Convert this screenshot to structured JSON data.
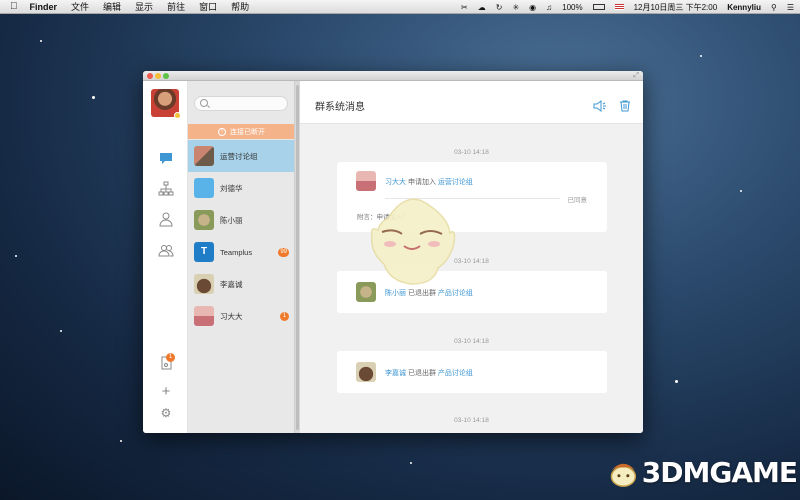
{
  "menubar": {
    "app": "Finder",
    "items": [
      "文件",
      "编辑",
      "显示",
      "前往",
      "窗口",
      "帮助"
    ],
    "battery": "100%",
    "datetime": "12月10日周三 下午2:00",
    "user": "Kennyliu"
  },
  "sidebar": {
    "nav": [
      "chat-bubble-icon",
      "org-chart-icon",
      "contact-icon",
      "group-icon"
    ],
    "bottom_badge": "1"
  },
  "conversations": {
    "alert": "连接已断开",
    "items": [
      {
        "name": "运营讨论组",
        "badge": "",
        "selected": true,
        "avatar_color": "#c9856f"
      },
      {
        "name": "刘德华",
        "badge": "",
        "selected": false,
        "avatar_color": "#5ab3e8"
      },
      {
        "name": "陈小丽",
        "badge": "",
        "selected": false,
        "avatar_color": "#8a9a5b"
      },
      {
        "name": "Teamplus",
        "badge": "99",
        "selected": false,
        "avatar_color": "#1f7cc7"
      },
      {
        "name": "李嘉诚",
        "badge": "",
        "selected": false,
        "avatar_color": "#6b4a35"
      },
      {
        "name": "习大大",
        "badge": "1",
        "selected": false,
        "avatar_color": "#c96f76"
      }
    ]
  },
  "main": {
    "title": "群系统消息",
    "messages": [
      {
        "time": "03-10 14:18",
        "user": "习大大",
        "action": "申请加入",
        "group": "运营讨论组",
        "status": "已同意",
        "attach": "附言：申请加入！"
      },
      {
        "time": "03-10 14:18",
        "user": "陈小丽",
        "action": "已退出群",
        "group": "产品讨论组"
      },
      {
        "time": "03-10 14:18",
        "user": "李嘉诚",
        "action": "已退出群",
        "group": "产品讨论组"
      },
      {
        "time": "03-10 14:18"
      }
    ]
  },
  "watermark": "3DMGAME",
  "colors": {
    "accent": "#3e97d3",
    "selected": "#a8d2ea",
    "alert": "#f5b38a",
    "badge": "#f07a2b"
  }
}
